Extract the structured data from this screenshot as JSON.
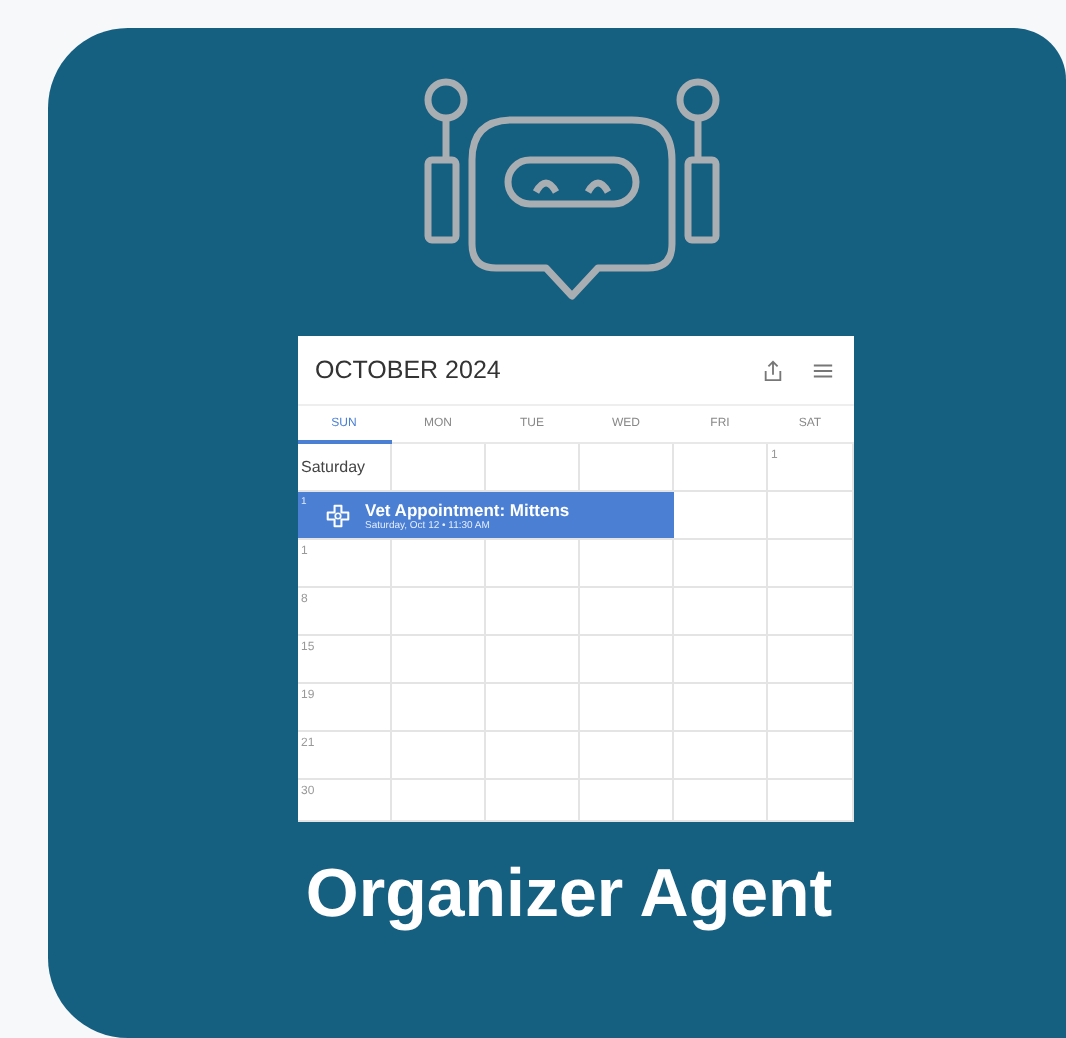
{
  "calendar": {
    "title": "OCTOBER 2024",
    "days": [
      {
        "label": "SUN",
        "selected": true
      },
      {
        "label": "MON",
        "selected": false
      },
      {
        "label": "TUE",
        "selected": false
      },
      {
        "label": "WED",
        "selected": false
      },
      {
        "label": "FRI",
        "selected": false
      },
      {
        "label": "SAT",
        "selected": false
      }
    ],
    "rows": [
      {
        "label": "Saturday",
        "last_cell": "1"
      },
      {
        "label": "1",
        "event": {
          "title": "Vet Appointment: Mittens",
          "detail": "Saturday, Oct 12 • 11:30 AM"
        }
      },
      {
        "label": "1"
      },
      {
        "label": "8"
      },
      {
        "label": "15"
      },
      {
        "label": "19"
      },
      {
        "label": "21"
      },
      {
        "label": "30"
      }
    ]
  },
  "title": "Organizer Agent"
}
